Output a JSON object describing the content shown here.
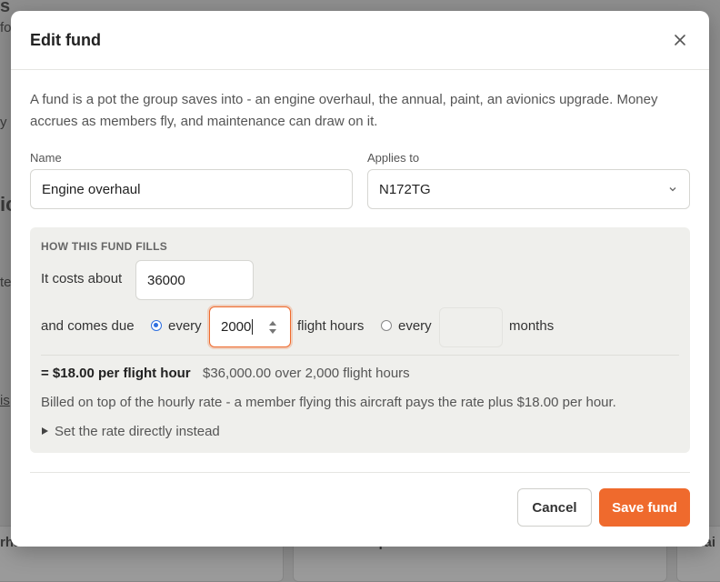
{
  "background": {
    "fragments": [
      "fo",
      "y",
      "ic",
      "te",
      "is",
      "rhaul",
      "Annual inspection",
      "Mai"
    ]
  },
  "modal": {
    "title": "Edit fund",
    "intro": "A fund is a pot the group saves into - an engine overhaul, the annual, paint, an avionics upgrade. Money accrues as members fly, and maintenance can draw on it.",
    "name_label": "Name",
    "name_value": "Engine overhaul",
    "applies_label": "Applies to",
    "applies_value": "N172TG",
    "fills": {
      "title": "HOW THIS FUND FILLS",
      "costs_label": "It costs about",
      "cost_value": "36000",
      "due_label": "and comes due",
      "every_label_1": "every",
      "hours_value": "2000",
      "hours_unit": "flight hours",
      "hours_selected": true,
      "every_label_2": "every",
      "months_value": "",
      "months_unit": "months",
      "rate_result": "= $18.00 per flight hour",
      "rate_detail": "$36,000.00 over 2,000 flight hours",
      "billed_note": "Billed on top of the hourly rate - a member flying this aircraft pays the rate plus $18.00 per hour.",
      "set_rate_toggle": "Set the rate directly instead"
    },
    "cancel_label": "Cancel",
    "save_label": "Save fund"
  },
  "colors": {
    "accent": "#ef6a2d",
    "radio_selected": "#2f6fe0",
    "panel_bg": "#efefec"
  }
}
